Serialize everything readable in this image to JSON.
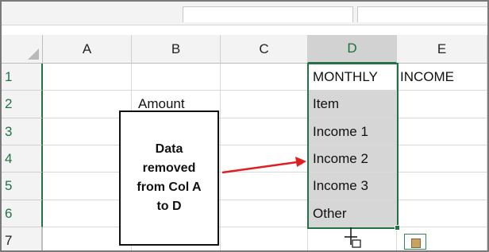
{
  "columns": [
    "A",
    "B",
    "C",
    "D",
    "E"
  ],
  "rows": [
    "1",
    "2",
    "3",
    "4",
    "5",
    "6",
    "7"
  ],
  "cells": {
    "D1": "MONTHLY",
    "E1": "INCOME",
    "B2": "Amount",
    "D2": "Item",
    "D3": "Income 1",
    "D4": "Income 2",
    "D5": "Income 3",
    "D6": "Other"
  },
  "callout": {
    "text": "Data\nremoved\nfrom Col A\nto D"
  },
  "colors": {
    "selection": "#217346",
    "arrow": "#e02020"
  },
  "icons": {
    "corner": "select-all-triangle",
    "cursor": "move-cursor-icon",
    "paste_options": "paste-options-icon"
  }
}
